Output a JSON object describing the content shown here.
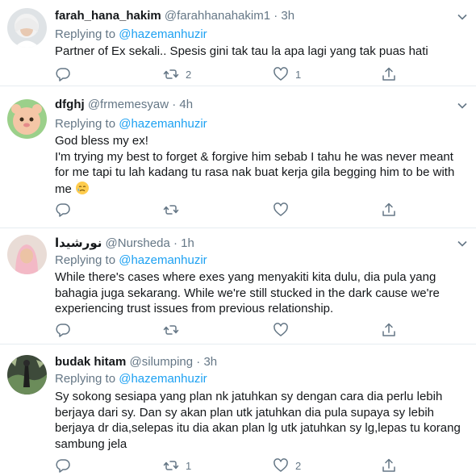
{
  "replying_label": "Replying to",
  "tweets": [
    {
      "name": "farah_hana_hakim",
      "handle": "@farahhanahakim1",
      "separator": "·",
      "time": "3h",
      "reply_to": "@hazemanhuzir",
      "lines": [
        "Partner of Ex sekali.. Spesis gini tak tau la apa lagi yang tak puas hati"
      ],
      "reply_count": "",
      "retweet_count": "2",
      "like_count": "1"
    },
    {
      "name": "dfghj",
      "handle": "@frmemesyaw",
      "separator": "·",
      "time": "4h",
      "reply_to": "@hazemanhuzir",
      "lines": [
        "God bless my ex!",
        "I'm trying my best to forget & forgive him  sebab I tahu he was never meant",
        "for me tapi tu lah kadang tu rasa nak buat kerja gila begging him to be with",
        "me"
      ],
      "reply_count": "",
      "retweet_count": "",
      "like_count": ""
    },
    {
      "name": "نورشيدا",
      "handle": "@Nursheda",
      "separator": "·",
      "time": "1h",
      "reply_to": "@hazemanhuzir",
      "lines": [
        "While there's cases where exes yang menyakiti kita dulu, dia pula yang",
        "bahagia juga sekarang. While we're still stucked in the dark cause we're",
        "experiencing trust issues from previous relationship."
      ],
      "reply_count": "",
      "retweet_count": "",
      "like_count": ""
    },
    {
      "name": "budak hitam",
      "handle": "@silumping",
      "separator": "·",
      "time": "3h",
      "reply_to": "@hazemanhuzir",
      "lines": [
        "Sy sokong sesiapa yang plan nk jatuhkan sy dengan cara dia perlu lebih",
        "berjaya dari sy. Dan sy akan plan utk jatuhkan dia pula supaya sy lebih",
        "berjaya dr dia,selepas itu dia akan plan lg utk jatuhkan sy lg,lepas tu korang",
        "sambung jela"
      ],
      "reply_count": "",
      "retweet_count": "1",
      "like_count": "2"
    }
  ],
  "colors": {
    "text": "#14171a",
    "muted": "#657786",
    "link": "#1da1f2",
    "divider": "#e6ecf0"
  },
  "icons": [
    "reply-icon",
    "retweet-icon",
    "like-icon",
    "share-icon",
    "chevron-down-icon"
  ]
}
